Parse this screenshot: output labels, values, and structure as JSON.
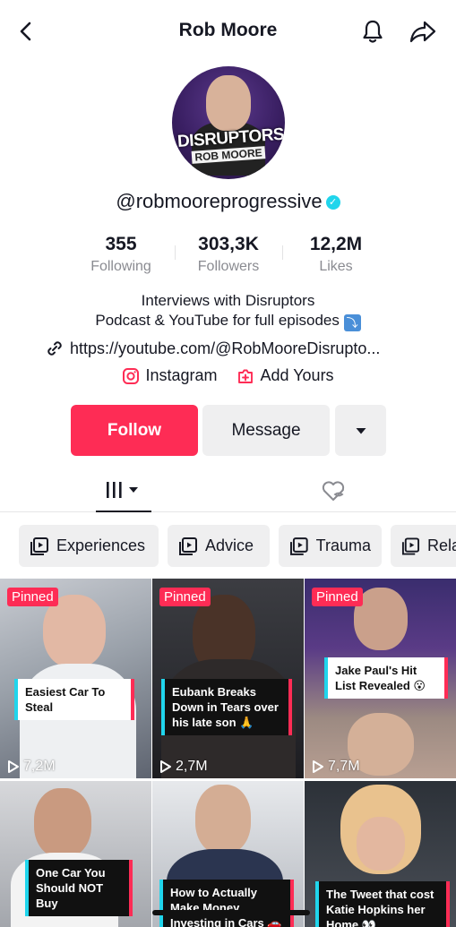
{
  "header": {
    "title": "Rob Moore"
  },
  "avatar": {
    "brand_line1": "DISRUPTORS",
    "brand_line2": "ROB MOORE"
  },
  "profile": {
    "username": "@robmooreprogressive",
    "verified_icon": "check"
  },
  "stats": [
    {
      "value": "355",
      "label": "Following"
    },
    {
      "value": "303,3K",
      "label": "Followers"
    },
    {
      "value": "12,2M",
      "label": "Likes"
    }
  ],
  "bio": {
    "line1": "Interviews with Disruptors",
    "line2": "Podcast & YouTube for full episodes",
    "arrow_emoji": "⤵"
  },
  "link": {
    "text": "https://youtube.com/@RobMooreDisrupto..."
  },
  "social": {
    "instagram": "Instagram",
    "add_yours": "Add Yours"
  },
  "actions": {
    "follow": "Follow",
    "message": "Message"
  },
  "chips": [
    "Experiences",
    "Advice",
    "Trauma",
    "Rela"
  ],
  "videos": [
    {
      "pinned": "Pinned",
      "caption": "Easiest Car To Steal",
      "views": "7,2M"
    },
    {
      "pinned": "Pinned",
      "caption": "Eubank Breaks Down in Tears over his late son 🙏",
      "views": "2,7M"
    },
    {
      "pinned": "Pinned",
      "caption": "Jake Paul's Hit List Revealed 😮",
      "views": "7,7M"
    },
    {
      "caption": "One Car You Should NOT Buy"
    },
    {
      "caption": "How to Actually Make Money Investing in Cars 🚗💰"
    },
    {
      "caption": "The Tweet that cost Katie Hopkins her Home 👀"
    }
  ],
  "colors": {
    "accent": "#fe2c55",
    "verified": "#20d5ec",
    "chip_bg": "#efeff0"
  }
}
